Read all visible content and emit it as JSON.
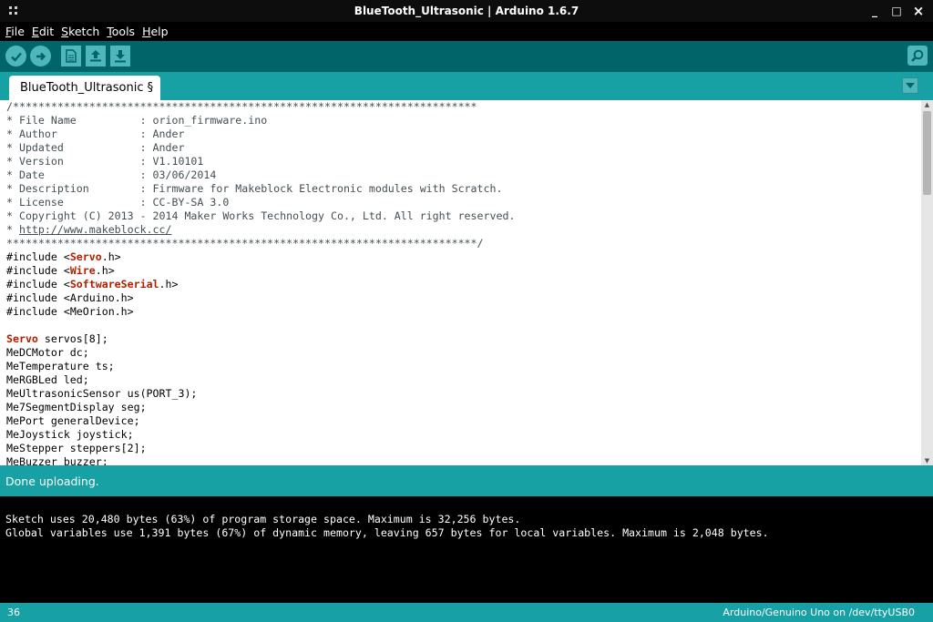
{
  "window": {
    "title": "BlueTooth_Ultrasonic | Arduino 1.6.7",
    "minimize": "_",
    "maximize": "□",
    "close": "×"
  },
  "menu": {
    "file": {
      "hot": "F",
      "rest": "ile"
    },
    "edit": {
      "hot": "E",
      "rest": "dit"
    },
    "sketch": {
      "hot": "S",
      "rest": "ketch"
    },
    "tools": {
      "hot": "T",
      "rest": "ools"
    },
    "help": {
      "hot": "H",
      "rest": "elp"
    }
  },
  "toolbar": {
    "icons": [
      "verify-icon",
      "upload-icon",
      "new-icon",
      "open-icon",
      "save-icon",
      "serial-monitor-icon"
    ]
  },
  "tab": {
    "label": "BlueTooth_Ultrasonic §"
  },
  "editor": {
    "header_top": "/*************************************************************************",
    "header_lines": [
      "* File Name          : orion_firmware.ino",
      "* Author             : Ander",
      "* Updated            : Ander",
      "* Version            : V1.10101",
      "* Date               : 03/06/2014",
      "* Description        : Firmware for Makeblock Electronic modules with Scratch.",
      "* License            : CC-BY-SA 3.0",
      "* Copyright (C) 2013 - 2014 Maker Works Technology Co., Ltd. All right reserved."
    ],
    "header_url_prefix": "* ",
    "header_url": "http://www.makeblock.cc/",
    "header_bottom": "**************************************************************************/",
    "include_prefix": "#include <",
    "include_suffix": ".h>",
    "includes": [
      {
        "name": "Servo",
        "highlight": true
      },
      {
        "name": "Wire",
        "highlight": true
      },
      {
        "name": "SoftwareSerial",
        "highlight": true
      },
      {
        "name": "Arduino",
        "highlight": false
      },
      {
        "name": "MeOrion",
        "highlight": false
      }
    ],
    "servo_kw": "Servo",
    "servo_rest": " servos[8];",
    "declarations": [
      "MeDCMotor dc;",
      "MeTemperature ts;",
      "MeRGBLed led;",
      "MeUltrasonicSensor us(PORT_3);",
      "Me7SegmentDisplay seg;",
      "MePort generalDevice;",
      "MeJoystick joystick;",
      "MeStepper steppers[2];",
      "MeBuzzer buzzer;"
    ]
  },
  "status": {
    "message": "Done uploading."
  },
  "console": {
    "lines": [
      "Sketch uses 20,480 bytes (63%) of program storage space. Maximum is 32,256 bytes.",
      "Global variables use 1,391 bytes (67%) of dynamic memory, leaving 657 bytes for local variables. Maximum is 2,048 bytes."
    ]
  },
  "footer": {
    "line_number": "36",
    "board": "Arduino/Genuino Uno on /dev/ttyUSB0"
  },
  "colors": {
    "teal": "#17a1a5",
    "dark_teal": "#006468",
    "button": "#4db7bb",
    "keyword": "#b02000"
  }
}
